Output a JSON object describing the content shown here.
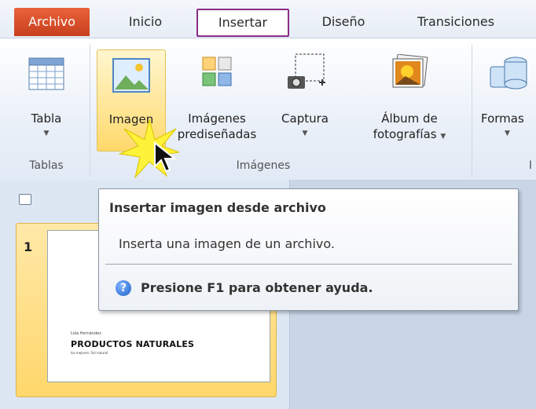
{
  "tabs": {
    "archivo": "Archivo",
    "inicio": "Inicio",
    "insertar": "Insertar",
    "diseno": "Diseño",
    "transiciones": "Transiciones"
  },
  "ribbon": {
    "tabla": {
      "label": "Tabla",
      "icon": "table-icon"
    },
    "imagen": {
      "label": "Imagen",
      "icon": "picture-icon"
    },
    "imagenes_prediseñadas": {
      "line1": "Imágenes",
      "line2": "prediseñadas",
      "icon": "clipart-icon"
    },
    "captura": {
      "label": "Captura",
      "icon": "screenshot-icon"
    },
    "album": {
      "line1": "Álbum de",
      "line2": "fotografías",
      "icon": "photo-album-icon"
    },
    "formas": {
      "label": "Formas",
      "icon": "shapes-icon"
    },
    "groups": {
      "tablas": "Tablas",
      "imagenes": "Imágenes",
      "next_partial": "I"
    }
  },
  "tooltip": {
    "title": "Insertar imagen desde archivo",
    "description": "Inserta una imagen de un archivo.",
    "help": "Presione F1 para obtener ayuda."
  },
  "slides": {
    "number": "1",
    "author": "Lola Hernández",
    "title": "PRODUCTOS NATURALES",
    "subtitle": "los mejores: Sol natural"
  },
  "colors": {
    "file_tab": "#d14a25",
    "active_tab_border": "#8a2c86",
    "selection": "#ffd86a"
  }
}
